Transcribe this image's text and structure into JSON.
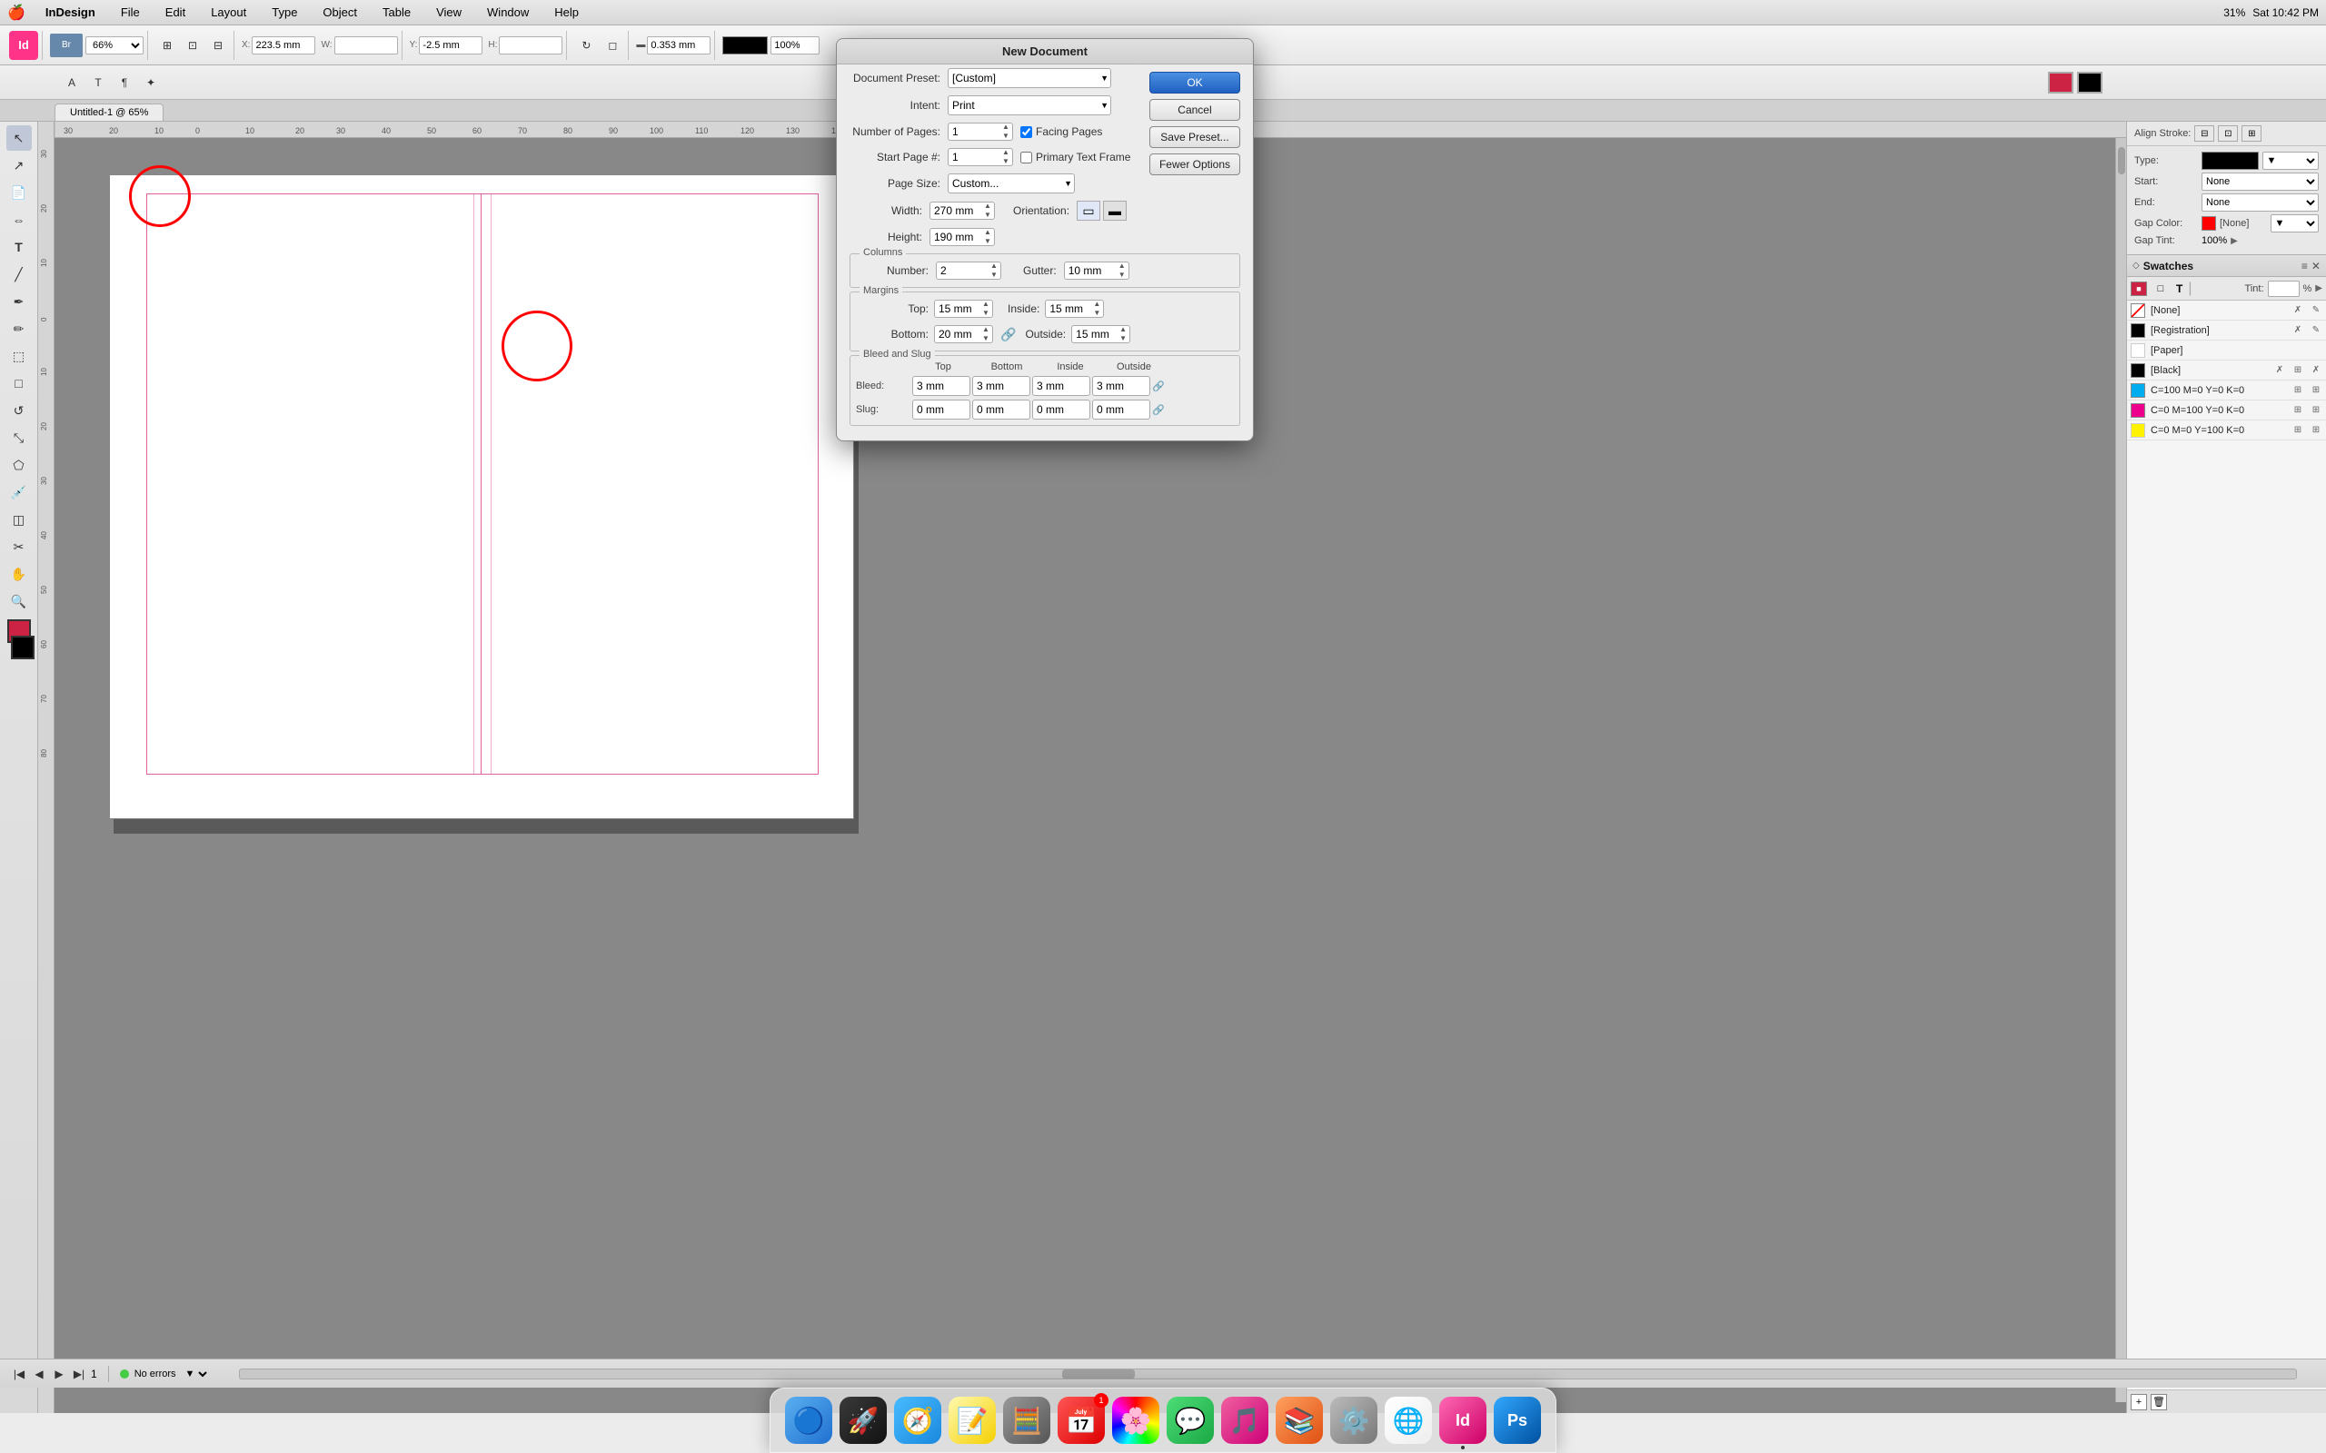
{
  "menubar": {
    "apple": "🍎",
    "app_name": "InDesign",
    "menus": [
      "File",
      "Edit",
      "Layout",
      "Type",
      "Object",
      "Table",
      "View",
      "Window",
      "Help"
    ],
    "right": {
      "time": "Sat 10:42 PM",
      "battery": "31%"
    }
  },
  "toolbar1": {
    "zoom_label": "66%",
    "x_label": "X:",
    "x_value": "223.5 mm",
    "y_label": "Y:",
    "y_value": "-2.5 mm",
    "w_label": "W:",
    "h_label": "H:",
    "stroke_value": "0.353 mm",
    "pct_value": "100%"
  },
  "tab": {
    "title": "Untitled-1 @ 65%"
  },
  "new_document_dialog": {
    "title": "New Document",
    "ok_label": "OK",
    "cancel_label": "Cancel",
    "save_preset_label": "Save Preset...",
    "fewer_options_label": "Fewer Options",
    "document_preset_label": "Document Preset:",
    "document_preset_value": "[Custom]",
    "intent_label": "Intent:",
    "intent_value": "Print",
    "num_pages_label": "Number of Pages:",
    "num_pages_value": "1",
    "facing_pages_label": "Facing Pages",
    "facing_pages_checked": true,
    "start_page_label": "Start Page #:",
    "start_page_value": "1",
    "primary_text_label": "Primary Text Frame",
    "primary_text_checked": false,
    "page_size_label": "Page Size:",
    "page_size_value": "Custom...",
    "width_label": "Width:",
    "width_value": "270 mm",
    "height_label": "Height:",
    "height_value": "190 mm",
    "orientation_label": "Orientation:",
    "columns_section": "Columns",
    "number_label": "Number:",
    "number_value": "2",
    "gutter_label": "Gutter:",
    "gutter_value": "10 mm",
    "margins_section": "Margins",
    "top_label": "Top:",
    "top_value": "15 mm",
    "inside_label": "Inside:",
    "inside_value": "15 mm",
    "bottom_label": "Bottom:",
    "bottom_value": "20 mm",
    "outside_label": "Outside:",
    "outside_value": "15 mm",
    "bleed_slug_section": "Bleed and Slug",
    "col_top": "Top",
    "col_bottom": "Bottom",
    "col_inside": "Inside",
    "col_outside": "Outside",
    "bleed_label": "Bleed:",
    "bleed_top": "3 mm",
    "bleed_bottom": "3 mm",
    "bleed_inside": "3 mm",
    "bleed_outside": "3 mm",
    "slug_label": "Slug:",
    "slug_top": "0 mm",
    "slug_bottom": "0 mm",
    "slug_inside": "0 mm",
    "slug_outside": "0 mm"
  },
  "right_panel": {
    "align_stroke_label": "Align Stroke:",
    "type_label": "Type:",
    "type_value": "",
    "start_label": "Start:",
    "start_value": "None",
    "end_label": "End:",
    "end_value": "None",
    "gap_color_label": "Gap Color:",
    "gap_color_value": "[None]",
    "gap_tint_label": "Gap Tint:",
    "gap_tint_value": "100%"
  },
  "swatches": {
    "title": "Swatches",
    "tint_label": "Tint:",
    "tint_value": "",
    "tint_pct": "%",
    "items": [
      {
        "name": "[None]",
        "color": "transparent",
        "has_x": true,
        "has_edit": true
      },
      {
        "name": "[Registration]",
        "color": "#000000",
        "has_x": true,
        "has_edit": true
      },
      {
        "name": "[Paper]",
        "color": "#ffffff",
        "has_x": false,
        "has_edit": false
      },
      {
        "name": "[Black]",
        "color": "#000000",
        "has_x": true,
        "has_edit": true
      },
      {
        "name": "C=100 M=0 Y=0 K=0",
        "color": "#00aeef",
        "has_x": false,
        "has_edit": true
      },
      {
        "name": "C=0 M=100 Y=0 K=0",
        "color": "#ec008c",
        "has_x": false,
        "has_edit": true
      },
      {
        "name": "C=0 M=0 Y=100 K=0",
        "color": "#fff200",
        "has_x": false,
        "has_edit": true
      }
    ]
  },
  "statusbar": {
    "page_label": "1",
    "no_errors": "No errors"
  },
  "dock": {
    "icons": [
      {
        "name": "finder",
        "label": "Finder",
        "emoji": "🔵",
        "active": false
      },
      {
        "name": "launchpad",
        "label": "Launchpad",
        "emoji": "🚀",
        "active": false
      },
      {
        "name": "safari",
        "label": "Safari",
        "emoji": "🧭",
        "active": false
      },
      {
        "name": "notes",
        "label": "Notes",
        "emoji": "📝",
        "active": false
      },
      {
        "name": "calc",
        "label": "Calculator",
        "emoji": "🔢",
        "active": false
      },
      {
        "name": "calendar",
        "label": "Calendar",
        "emoji": "📅",
        "active": true,
        "badge": "1"
      },
      {
        "name": "photos",
        "label": "Photos",
        "emoji": "🌸",
        "active": false
      },
      {
        "name": "imessage",
        "label": "Messages",
        "emoji": "💬",
        "active": false
      },
      {
        "name": "itunes",
        "label": "iTunes",
        "emoji": "🎵",
        "active": false
      },
      {
        "name": "books",
        "label": "Books",
        "emoji": "📚",
        "active": false
      },
      {
        "name": "settings",
        "label": "System Preferences",
        "emoji": "⚙️",
        "active": false
      },
      {
        "name": "chrome",
        "label": "Chrome",
        "emoji": "🌐",
        "active": false
      },
      {
        "name": "indesign",
        "label": "InDesign",
        "emoji": "Id",
        "active": true
      },
      {
        "name": "photoshop",
        "label": "Photoshop",
        "emoji": "Ps",
        "active": false
      }
    ]
  }
}
